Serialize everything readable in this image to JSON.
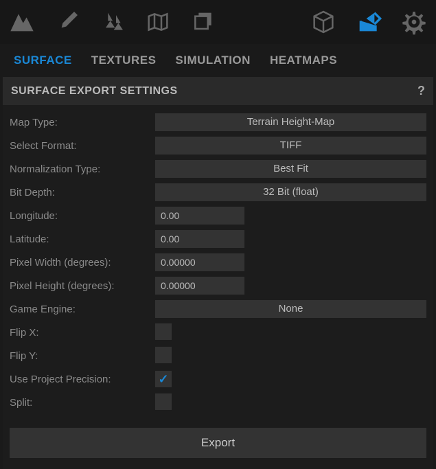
{
  "toolbar": {
    "icons": [
      "mountain",
      "brush",
      "trees",
      "map",
      "layers",
      "cube",
      "share",
      "gear"
    ],
    "active": "share"
  },
  "tabs": {
    "items": [
      "SURFACE",
      "TEXTURES",
      "SIMULATION",
      "HEATMAPS"
    ],
    "active": "SURFACE"
  },
  "panel": {
    "title": "SURFACE EXPORT SETTINGS",
    "help": "?"
  },
  "form": {
    "map_type": {
      "label": "Map Type:",
      "value": "Terrain Height-Map"
    },
    "select_format": {
      "label": "Select Format:",
      "value": "TIFF"
    },
    "normalization_type": {
      "label": "Normalization Type:",
      "value": "Best Fit"
    },
    "bit_depth": {
      "label": "Bit Depth:",
      "value": "32 Bit (float)"
    },
    "longitude": {
      "label": "Longitude:",
      "value": "0.00"
    },
    "latitude": {
      "label": "Latitude:",
      "value": "0.00"
    },
    "pixel_width": {
      "label": "Pixel Width (degrees):",
      "value": "0.00000"
    },
    "pixel_height": {
      "label": "Pixel Height (degrees):",
      "value": "0.00000"
    },
    "game_engine": {
      "label": "Game Engine:",
      "value": "None"
    },
    "flip_x": {
      "label": "Flip X:",
      "checked": false
    },
    "flip_y": {
      "label": "Flip Y:",
      "checked": false
    },
    "use_project_precision": {
      "label": "Use Project Precision:",
      "checked": true
    },
    "split": {
      "label": "Split:",
      "checked": false
    }
  },
  "export_button": "Export"
}
